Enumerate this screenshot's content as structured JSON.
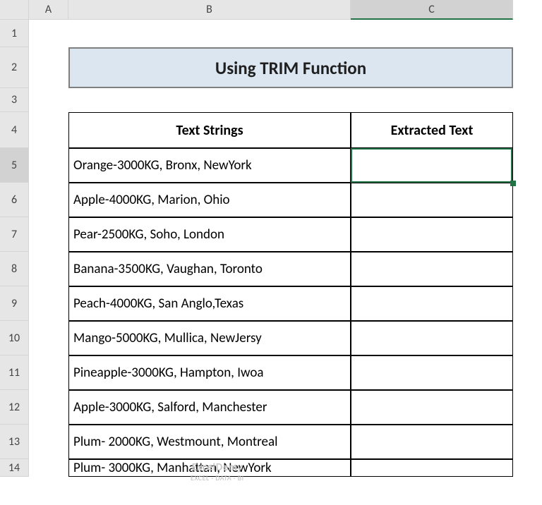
{
  "columns": [
    "A",
    "B",
    "C"
  ],
  "rows": [
    "1",
    "2",
    "3",
    "4",
    "5",
    "6",
    "7",
    "8",
    "9",
    "10",
    "11",
    "12",
    "13",
    "14"
  ],
  "selected_row": "5",
  "selected_col": "C",
  "title": "Using TRIM Function",
  "headers": {
    "text_strings": "Text Strings",
    "extracted": "Extracted Text"
  },
  "data": [
    "Orange-3000KG, Bronx, NewYork",
    "Apple-4000KG, Marion, Ohio",
    "Pear-2500KG, Soho, London",
    "Banana-3500KG, Vaughan, Toronto",
    "Peach-4000KG, San Anglo,Texas",
    "Mango-5000KG, Mullica, NewJersy",
    "Pineapple-3000KG, Hampton, Iwoa",
    "Apple-3000KG, Salford, Manchester",
    "Plum- 2000KG, Westmount, Montreal",
    "Plum- 3000KG, Manhattan, NewYork"
  ],
  "watermark": {
    "line1": "ExcelDemy",
    "line2": "EXCEL · DATA · BI"
  },
  "chart_data": {
    "type": "table",
    "title": "Using TRIM Function",
    "columns": [
      "Text Strings",
      "Extracted Text"
    ],
    "rows": [
      [
        "Orange-3000KG, Bronx, NewYork",
        ""
      ],
      [
        "Apple-4000KG, Marion, Ohio",
        ""
      ],
      [
        "Pear-2500KG, Soho, London",
        ""
      ],
      [
        "Banana-3500KG, Vaughan, Toronto",
        ""
      ],
      [
        "Peach-4000KG, San Anglo,Texas",
        ""
      ],
      [
        "Mango-5000KG, Mullica, NewJersy",
        ""
      ],
      [
        "Pineapple-3000KG, Hampton, Iwoa",
        ""
      ],
      [
        "Apple-3000KG, Salford, Manchester",
        ""
      ],
      [
        "Plum- 2000KG, Westmount, Montreal",
        ""
      ],
      [
        "Plum- 3000KG, Manhattan, NewYork",
        ""
      ]
    ]
  }
}
